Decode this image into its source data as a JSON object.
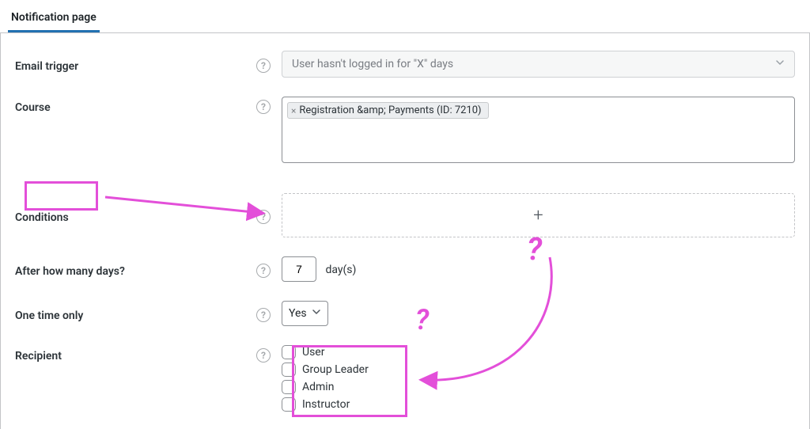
{
  "tab": {
    "label": "Notification page"
  },
  "rows": {
    "email_trigger": {
      "label": "Email trigger",
      "value": "User hasn't logged in for \"X\" days"
    },
    "course": {
      "label": "Course",
      "tag_text": "Registration &amp; Payments (ID: 7210)"
    },
    "conditions": {
      "label": "Conditions",
      "add_symbol": "+"
    },
    "after_days": {
      "label": "After how many days?",
      "value": "7",
      "suffix": "day(s)"
    },
    "one_time": {
      "label": "One time only",
      "value": "Yes"
    },
    "recipient": {
      "label": "Recipient",
      "options": [
        "User",
        "Group Leader",
        "Admin",
        "Instructor"
      ]
    }
  },
  "annotations": {
    "q1": "?",
    "q2": "?",
    "color": "#e34fd9"
  }
}
